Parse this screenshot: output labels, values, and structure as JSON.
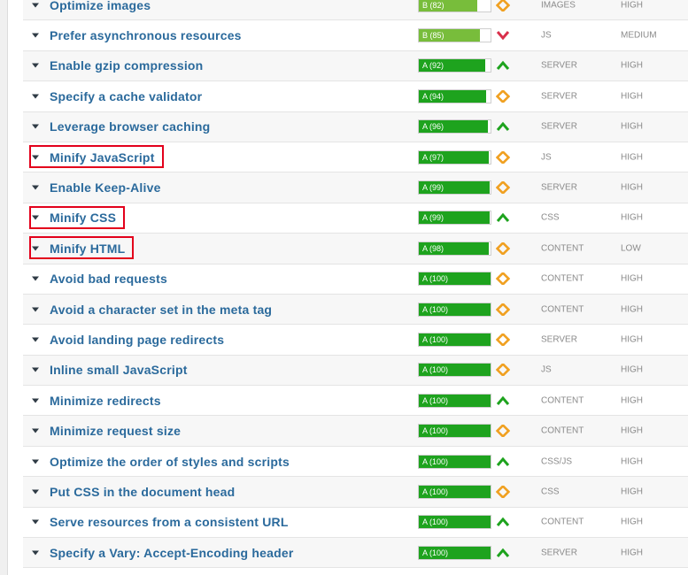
{
  "colors": {
    "grade_A": "#1ea31e",
    "grade_B": "#78bd3b",
    "trend_up": "#1ea31e",
    "trend_down": "#d9304b",
    "trend_neutral": "#f0a020",
    "link": "#2b6a9c",
    "highlight": "#e3001b"
  },
  "rows": [
    {
      "name": "Optimize images",
      "grade": "B (82)",
      "score": 82,
      "letter": "B",
      "trend": "neutral",
      "type": "IMAGES",
      "priority": "HIGH",
      "highlighted": false
    },
    {
      "name": "Prefer asynchronous resources",
      "grade": "B (85)",
      "score": 85,
      "letter": "B",
      "trend": "down",
      "type": "JS",
      "priority": "MEDIUM",
      "highlighted": false
    },
    {
      "name": "Enable gzip compression",
      "grade": "A (92)",
      "score": 92,
      "letter": "A",
      "trend": "up",
      "type": "SERVER",
      "priority": "HIGH",
      "highlighted": false
    },
    {
      "name": "Specify a cache validator",
      "grade": "A (94)",
      "score": 94,
      "letter": "A",
      "trend": "neutral",
      "type": "SERVER",
      "priority": "HIGH",
      "highlighted": false
    },
    {
      "name": "Leverage browser caching",
      "grade": "A (96)",
      "score": 96,
      "letter": "A",
      "trend": "up",
      "type": "SERVER",
      "priority": "HIGH",
      "highlighted": false
    },
    {
      "name": "Minify JavaScript",
      "grade": "A (97)",
      "score": 97,
      "letter": "A",
      "trend": "neutral",
      "type": "JS",
      "priority": "HIGH",
      "highlighted": true
    },
    {
      "name": "Enable Keep-Alive",
      "grade": "A (99)",
      "score": 99,
      "letter": "A",
      "trend": "neutral",
      "type": "SERVER",
      "priority": "HIGH",
      "highlighted": false
    },
    {
      "name": "Minify CSS",
      "grade": "A (99)",
      "score": 99,
      "letter": "A",
      "trend": "up",
      "type": "CSS",
      "priority": "HIGH",
      "highlighted": true
    },
    {
      "name": "Minify HTML",
      "grade": "A (98)",
      "score": 98,
      "letter": "A",
      "trend": "neutral",
      "type": "CONTENT",
      "priority": "LOW",
      "highlighted": true
    },
    {
      "name": "Avoid bad requests",
      "grade": "A (100)",
      "score": 100,
      "letter": "A",
      "trend": "neutral",
      "type": "CONTENT",
      "priority": "HIGH",
      "highlighted": false
    },
    {
      "name": "Avoid a character set in the meta tag",
      "grade": "A (100)",
      "score": 100,
      "letter": "A",
      "trend": "neutral",
      "type": "CONTENT",
      "priority": "HIGH",
      "highlighted": false
    },
    {
      "name": "Avoid landing page redirects",
      "grade": "A (100)",
      "score": 100,
      "letter": "A",
      "trend": "neutral",
      "type": "SERVER",
      "priority": "HIGH",
      "highlighted": false
    },
    {
      "name": "Inline small JavaScript",
      "grade": "A (100)",
      "score": 100,
      "letter": "A",
      "trend": "neutral",
      "type": "JS",
      "priority": "HIGH",
      "highlighted": false
    },
    {
      "name": "Minimize redirects",
      "grade": "A (100)",
      "score": 100,
      "letter": "A",
      "trend": "up",
      "type": "CONTENT",
      "priority": "HIGH",
      "highlighted": false
    },
    {
      "name": "Minimize request size",
      "grade": "A (100)",
      "score": 100,
      "letter": "A",
      "trend": "neutral",
      "type": "CONTENT",
      "priority": "HIGH",
      "highlighted": false
    },
    {
      "name": "Optimize the order of styles and scripts",
      "grade": "A (100)",
      "score": 100,
      "letter": "A",
      "trend": "up",
      "type": "CSS/JS",
      "priority": "HIGH",
      "highlighted": false
    },
    {
      "name": "Put CSS in the document head",
      "grade": "A (100)",
      "score": 100,
      "letter": "A",
      "trend": "neutral",
      "type": "CSS",
      "priority": "HIGH",
      "highlighted": false
    },
    {
      "name": "Serve resources from a consistent URL",
      "grade": "A (100)",
      "score": 100,
      "letter": "A",
      "trend": "up",
      "type": "CONTENT",
      "priority": "HIGH",
      "highlighted": false
    },
    {
      "name": "Specify a Vary: Accept-Encoding header",
      "grade": "A (100)",
      "score": 100,
      "letter": "A",
      "trend": "up",
      "type": "SERVER",
      "priority": "HIGH",
      "highlighted": false
    }
  ]
}
